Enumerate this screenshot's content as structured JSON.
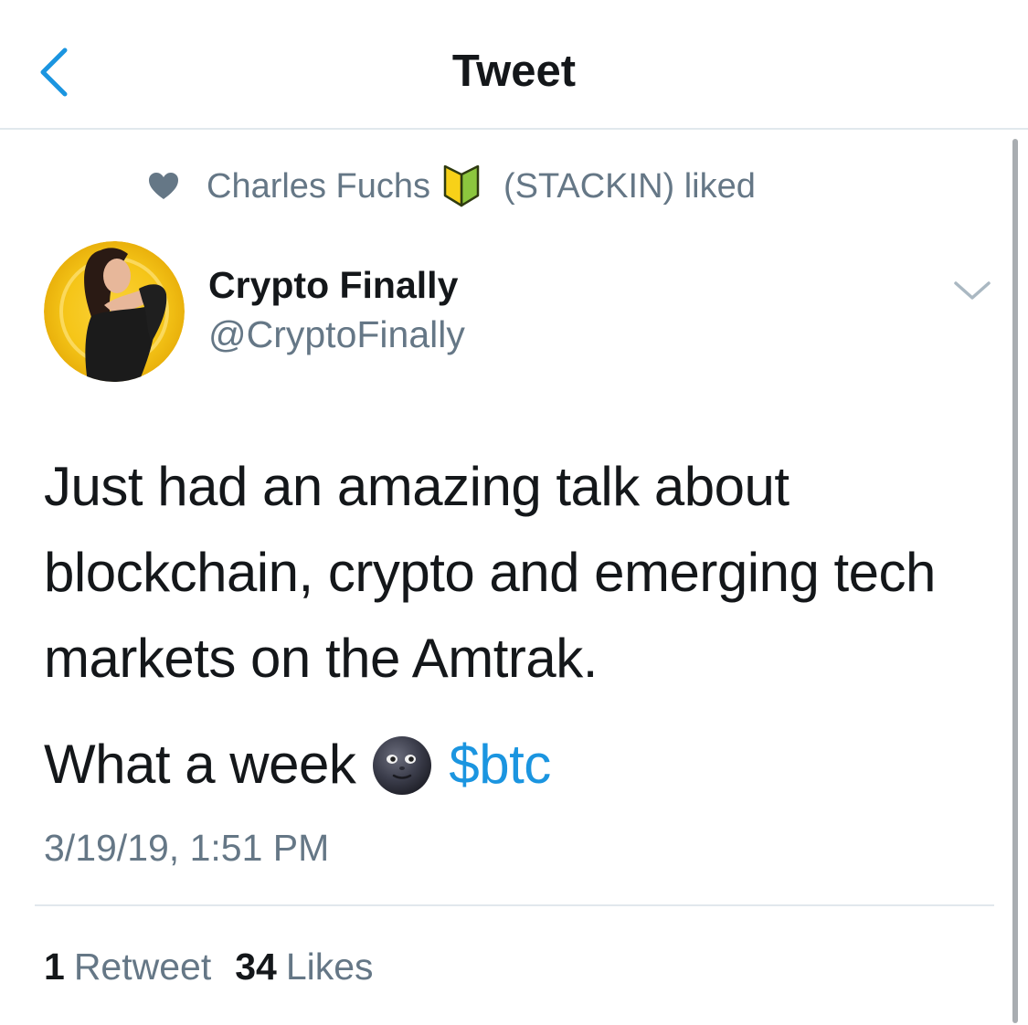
{
  "header": {
    "title": "Tweet",
    "back_icon": "chevron-left-icon"
  },
  "social_context": {
    "icon": "heart-icon",
    "liker_name": "Charles Fuchs",
    "badge_emoji": "japanese-beginner-badge-icon",
    "suffix": "(STACKIN) liked"
  },
  "author": {
    "name": "Crypto Finally",
    "handle": "@CryptoFinally",
    "menu_icon": "chevron-down-icon"
  },
  "tweet": {
    "line1": "Just had an amazing talk about",
    "line2": "blockchain, crypto and emerging tech",
    "line3": "markets on the Amtrak.",
    "line4_prefix": "What a week",
    "emoji": "new-moon-face-icon",
    "cashtag": "$btc",
    "timestamp": "3/19/19, 1:51 PM"
  },
  "stats": {
    "retweet_count": "1",
    "retweet_label": "Retweet",
    "likes_count": "34",
    "likes_label": "Likes"
  },
  "colors": {
    "accent": "#1b95e0",
    "secondary_text": "#657786",
    "primary_text": "#14171a",
    "divider": "#e1e8ed"
  }
}
